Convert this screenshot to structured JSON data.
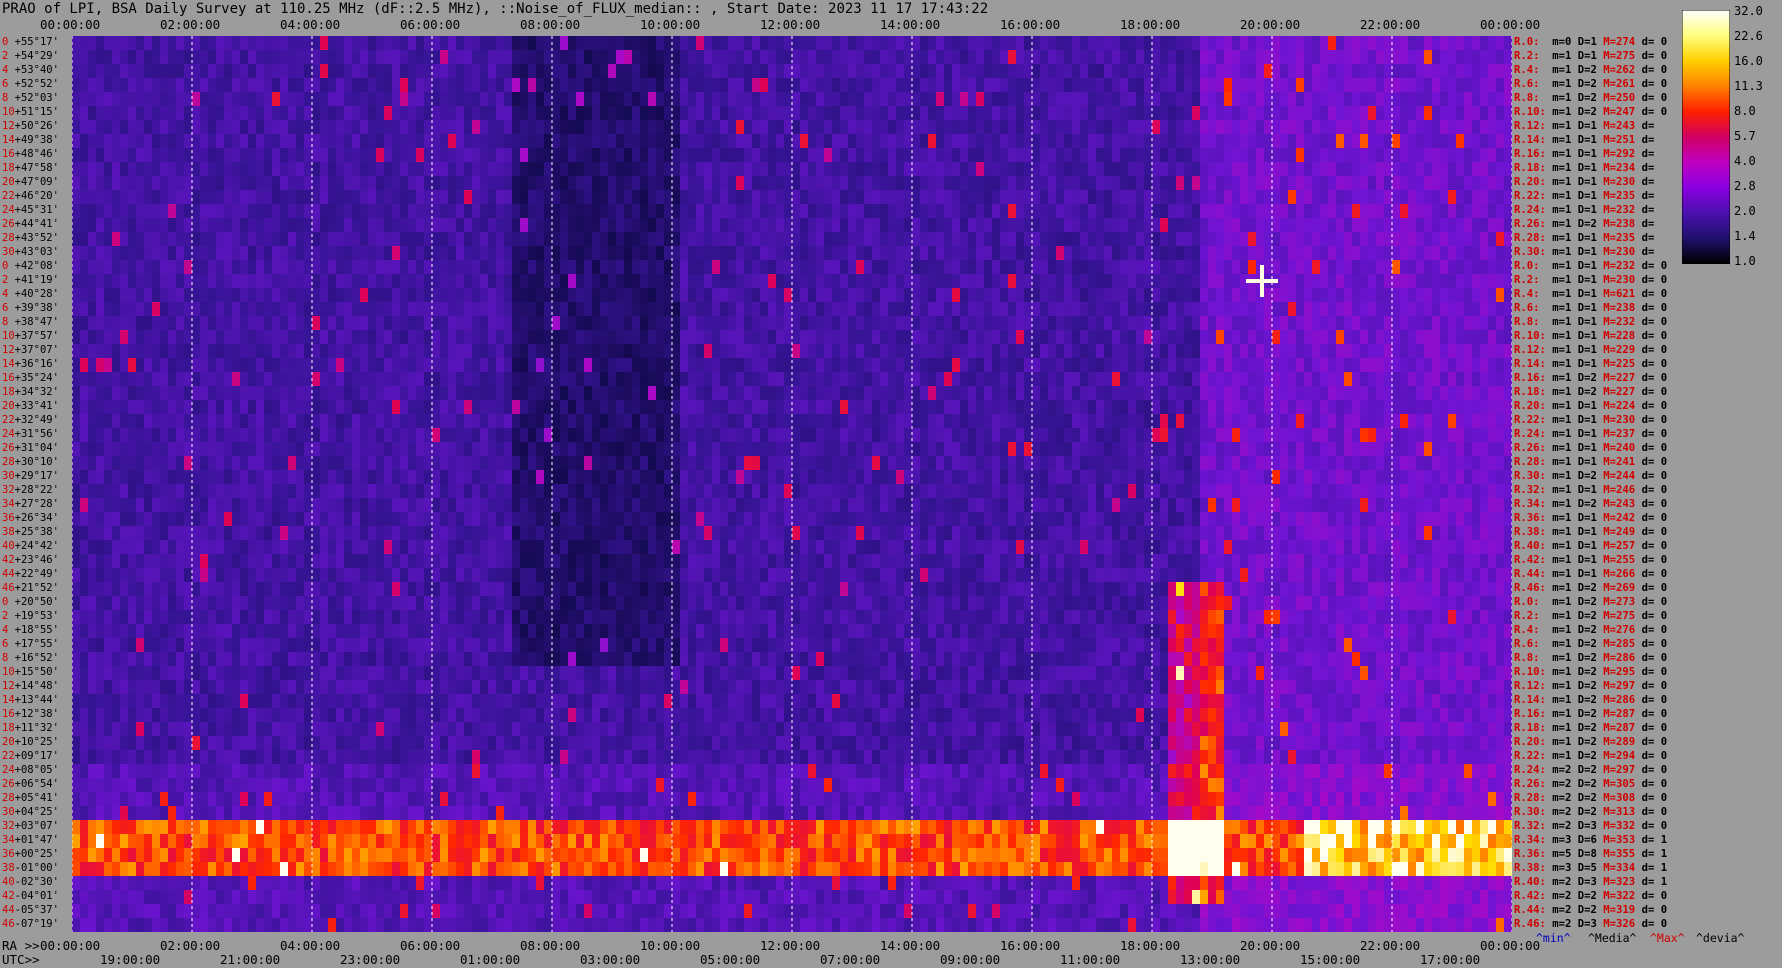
{
  "title": "PRAO of LPI, BSA Daily Survey at 110.25 MHz (dF::2.5 MHz), ::Noise_of_FLUX_median:: , Start Date: 2023 11 17 17:43:22",
  "top_ticks": [
    "00:00:00",
    "02:00:00",
    "04:00:00",
    "06:00:00",
    "08:00:00",
    "10:00:00",
    "12:00:00",
    "14:00:00",
    "16:00:00",
    "18:00:00",
    "20:00:00",
    "22:00:00",
    "00:00:00"
  ],
  "ra_label": "RA >>",
  "ra_ticks": [
    "00:00:00",
    "02:00:00",
    "04:00:00",
    "06:00:00",
    "08:00:00",
    "10:00:00",
    "12:00:00",
    "14:00:00",
    "16:00:00",
    "18:00:00",
    "20:00:00",
    "22:00:00",
    "00:00:00"
  ],
  "utc_label": "UTC>>",
  "utc_ticks": [
    "19:00:00",
    "21:00:00",
    "23:00:00",
    "01:00:00",
    "03:00:00",
    "05:00:00",
    "07:00:00",
    "09:00:00",
    "11:00:00",
    "13:00:00",
    "15:00:00",
    "17:00:00"
  ],
  "colorbar": {
    "ticks": [
      "32.0",
      "22.6",
      "16.0",
      "11.3",
      "8.0",
      "5.7",
      "4.0",
      "2.8",
      "2.0",
      "1.4",
      "1.0"
    ],
    "stops": [
      "#ffffff",
      "#ffff80",
      "#ffd000",
      "#ff8000",
      "#ff2000",
      "#d00060",
      "#c000c0",
      "#8a00e0",
      "#4a10b0",
      "#20106a",
      "#000000"
    ]
  },
  "dec_labels": [
    "+55°17'",
    "+54°29'",
    "+53°40'",
    "+52°52'",
    "+52°03'",
    "+51°15'",
    "+50°26'",
    "+49°38'",
    "+48°46'",
    "+47°58'",
    "+47°09'",
    "+46°20'",
    "+45°31'",
    "+44°41'",
    "+43°52'",
    "+43°03'",
    "+42°08'",
    "+41°19'",
    "+40°28'",
    "+39°38'",
    "+38°47'",
    "+37°57'",
    "+37°07'",
    "+36°16'",
    "+35°24'",
    "+34°32'",
    "+33°41'",
    "+32°49'",
    "+31°56'",
    "+31°04'",
    "+30°10'",
    "+29°17'",
    "+28°22'",
    "+27°28'",
    "+26°34'",
    "+25°38'",
    "+24°42'",
    "+23°46'",
    "+22°49'",
    "+21°52'",
    "+20°50'",
    "+19°53'",
    "+18°55'",
    "+17°55'",
    "+16°52'",
    "+15°50'",
    "+14°48'",
    "+13°44'",
    "+12°38'",
    "+11°32'",
    "+10°25'",
    "+09°17'",
    "+08°05'",
    "+06°54'",
    "+05°41'",
    "+04°25'",
    "+03°07'",
    "+01°47'",
    "+00°25'",
    "-01°00'",
    "-02°30'",
    "-04°01'",
    "-05°37'",
    "-07°19'"
  ],
  "dec_indices": [
    "0",
    "2",
    "4",
    "6",
    "8",
    "10",
    "12",
    "14",
    "16",
    "18",
    "20",
    "22",
    "24",
    "26",
    "28",
    "30",
    "0",
    "2",
    "4",
    "6",
    "8",
    "10",
    "12",
    "14",
    "16",
    "18",
    "20",
    "22",
    "24",
    "26",
    "28",
    "30",
    "32",
    "34",
    "36",
    "38",
    "40",
    "42",
    "44",
    "46",
    "0",
    "2",
    "4",
    "6",
    "8",
    "10",
    "12",
    "14",
    "16",
    "18",
    "20",
    "22",
    "24",
    "26",
    "28",
    "30",
    "32",
    "34",
    "36",
    "38",
    "40",
    "42",
    "44",
    "46"
  ],
  "beams": [
    {
      "r": "R.0:",
      "m": "m=0",
      "d": "D=1",
      "mx": "M=274",
      "dv": "d= 0"
    },
    {
      "r": "R.2:",
      "m": "m=1",
      "d": "D=1",
      "mx": "M=275",
      "dv": "d= 0"
    },
    {
      "r": "R.4:",
      "m": "m=1",
      "d": "D=2",
      "mx": "M=262",
      "dv": "d= 0"
    },
    {
      "r": "R.6:",
      "m": "m=1",
      "d": "D=2",
      "mx": "M=261",
      "dv": "d= 0"
    },
    {
      "r": "R.8:",
      "m": "m=1",
      "d": "D=2",
      "mx": "M=250",
      "dv": "d= 0"
    },
    {
      "r": "R.10:",
      "m": "m=1",
      "d": "D=2",
      "mx": "M=247",
      "dv": "d= 0"
    },
    {
      "r": "R.12:",
      "m": "m=1",
      "d": "D=1",
      "mx": "M=243",
      "dv": "d="
    },
    {
      "r": "R.14:",
      "m": "m=1",
      "d": "D=1",
      "mx": "M=251",
      "dv": "d="
    },
    {
      "r": "R.16:",
      "m": "m=1",
      "d": "D=1",
      "mx": "M=292",
      "dv": "d="
    },
    {
      "r": "R.18:",
      "m": "m=1",
      "d": "D=1",
      "mx": "M=234",
      "dv": "d="
    },
    {
      "r": "R.20:",
      "m": "m=1",
      "d": "D=1",
      "mx": "M=230",
      "dv": "d="
    },
    {
      "r": "R.22:",
      "m": "m=1",
      "d": "D=1",
      "mx": "M=235",
      "dv": "d="
    },
    {
      "r": "R.24:",
      "m": "m=1",
      "d": "D=1",
      "mx": "M=232",
      "dv": "d="
    },
    {
      "r": "R.26:",
      "m": "m=1",
      "d": "D=2",
      "mx": "M=238",
      "dv": "d="
    },
    {
      "r": "R.28:",
      "m": "m=1",
      "d": "D=1",
      "mx": "M=235",
      "dv": "d="
    },
    {
      "r": "R.30:",
      "m": "m=1",
      "d": "D=1",
      "mx": "M=230",
      "dv": "d="
    },
    {
      "r": "R.0:",
      "m": "m=1",
      "d": "D=1",
      "mx": "M=232",
      "dv": "d= 0"
    },
    {
      "r": "R.2:",
      "m": "m=1",
      "d": "D=1",
      "mx": "M=230",
      "dv": "d= 0"
    },
    {
      "r": "R.4:",
      "m": "m=1",
      "d": "D=1",
      "mx": "M=621",
      "dv": "d= 0"
    },
    {
      "r": "R.6:",
      "m": "m=1",
      "d": "D=1",
      "mx": "M=238",
      "dv": "d= 0"
    },
    {
      "r": "R.8:",
      "m": "m=1",
      "d": "D=1",
      "mx": "M=232",
      "dv": "d= 0"
    },
    {
      "r": "R.10:",
      "m": "m=1",
      "d": "D=1",
      "mx": "M=228",
      "dv": "d= 0"
    },
    {
      "r": "R.12:",
      "m": "m=1",
      "d": "D=1",
      "mx": "M=229",
      "dv": "d= 0"
    },
    {
      "r": "R.14:",
      "m": "m=1",
      "d": "D=1",
      "mx": "M=225",
      "dv": "d= 0"
    },
    {
      "r": "R.16:",
      "m": "m=1",
      "d": "D=2",
      "mx": "M=227",
      "dv": "d= 0"
    },
    {
      "r": "R.18:",
      "m": "m=1",
      "d": "D=2",
      "mx": "M=227",
      "dv": "d= 0"
    },
    {
      "r": "R.20:",
      "m": "m=1",
      "d": "D=1",
      "mx": "M=224",
      "dv": "d= 0"
    },
    {
      "r": "R.22:",
      "m": "m=1",
      "d": "D=1",
      "mx": "M=230",
      "dv": "d= 0"
    },
    {
      "r": "R.24:",
      "m": "m=1",
      "d": "D=1",
      "mx": "M=237",
      "dv": "d= 0"
    },
    {
      "r": "R.26:",
      "m": "m=1",
      "d": "D=1",
      "mx": "M=240",
      "dv": "d= 0"
    },
    {
      "r": "R.28:",
      "m": "m=1",
      "d": "D=1",
      "mx": "M=241",
      "dv": "d= 0"
    },
    {
      "r": "R.30:",
      "m": "m=1",
      "d": "D=2",
      "mx": "M=244",
      "dv": "d= 0"
    },
    {
      "r": "R.32:",
      "m": "m=1",
      "d": "D=1",
      "mx": "M=246",
      "dv": "d= 0"
    },
    {
      "r": "R.34:",
      "m": "m=1",
      "d": "D=2",
      "mx": "M=243",
      "dv": "d= 0"
    },
    {
      "r": "R.36:",
      "m": "m=1",
      "d": "D=1",
      "mx": "M=242",
      "dv": "d= 0"
    },
    {
      "r": "R.38:",
      "m": "m=1",
      "d": "D=1",
      "mx": "M=249",
      "dv": "d= 0"
    },
    {
      "r": "R.40:",
      "m": "m=1",
      "d": "D=1",
      "mx": "M=257",
      "dv": "d= 0"
    },
    {
      "r": "R.42:",
      "m": "m=1",
      "d": "D=1",
      "mx": "M=255",
      "dv": "d= 0"
    },
    {
      "r": "R.44:",
      "m": "m=1",
      "d": "D=1",
      "mx": "M=266",
      "dv": "d= 0"
    },
    {
      "r": "R.46:",
      "m": "m=1",
      "d": "D=2",
      "mx": "M=269",
      "dv": "d= 0"
    },
    {
      "r": "R.0:",
      "m": "m=1",
      "d": "D=2",
      "mx": "M=273",
      "dv": "d= 0"
    },
    {
      "r": "R.2:",
      "m": "m=1",
      "d": "D=2",
      "mx": "M=275",
      "dv": "d= 0"
    },
    {
      "r": "R.4:",
      "m": "m=1",
      "d": "D=2",
      "mx": "M=276",
      "dv": "d= 0"
    },
    {
      "r": "R.6:",
      "m": "m=1",
      "d": "D=2",
      "mx": "M=285",
      "dv": "d= 0"
    },
    {
      "r": "R.8:",
      "m": "m=1",
      "d": "D=2",
      "mx": "M=286",
      "dv": "d= 0"
    },
    {
      "r": "R.10:",
      "m": "m=1",
      "d": "D=2",
      "mx": "M=295",
      "dv": "d= 0"
    },
    {
      "r": "R.12:",
      "m": "m=1",
      "d": "D=2",
      "mx": "M=297",
      "dv": "d= 0"
    },
    {
      "r": "R.14:",
      "m": "m=1",
      "d": "D=2",
      "mx": "M=286",
      "dv": "d= 0"
    },
    {
      "r": "R.16:",
      "m": "m=1",
      "d": "D=2",
      "mx": "M=287",
      "dv": "d= 0"
    },
    {
      "r": "R.18:",
      "m": "m=1",
      "d": "D=2",
      "mx": "M=287",
      "dv": "d= 0"
    },
    {
      "r": "R.20:",
      "m": "m=1",
      "d": "D=2",
      "mx": "M=289",
      "dv": "d= 0"
    },
    {
      "r": "R.22:",
      "m": "m=1",
      "d": "D=2",
      "mx": "M=294",
      "dv": "d= 0"
    },
    {
      "r": "R.24:",
      "m": "m=2",
      "d": "D=2",
      "mx": "M=297",
      "dv": "d= 0"
    },
    {
      "r": "R.26:",
      "m": "m=2",
      "d": "D=2",
      "mx": "M=305",
      "dv": "d= 0"
    },
    {
      "r": "R.28:",
      "m": "m=2",
      "d": "D=2",
      "mx": "M=308",
      "dv": "d= 0"
    },
    {
      "r": "R.30:",
      "m": "m=2",
      "d": "D=2",
      "mx": "M=313",
      "dv": "d= 0"
    },
    {
      "r": "R.32:",
      "m": "m=2",
      "d": "D=3",
      "mx": "M=332",
      "dv": "d= 0"
    },
    {
      "r": "R.34:",
      "m": "m=3",
      "d": "D=6",
      "mx": "M=353",
      "dv": "d= 1"
    },
    {
      "r": "R.36:",
      "m": "m=5",
      "d": "D=8",
      "mx": "M=355",
      "dv": "d= 1"
    },
    {
      "r": "R.38:",
      "m": "m=3",
      "d": "D=5",
      "mx": "M=334",
      "dv": "d= 1"
    },
    {
      "r": "R.40:",
      "m": "m=2",
      "d": "D=3",
      "mx": "M=323",
      "dv": "d= 1"
    },
    {
      "r": "R.42:",
      "m": "m=2",
      "d": "D=2",
      "mx": "M=322",
      "dv": "d= 0"
    },
    {
      "r": "R.44:",
      "m": "m=2",
      "d": "D=2",
      "mx": "M=319",
      "dv": "d= 0"
    },
    {
      "r": "R.46:",
      "m": "m=2",
      "d": "D=3",
      "mx": "M=326",
      "dv": "d= 0"
    }
  ],
  "footer": {
    "min": "^min^",
    "median": "^Media^",
    "max": "^Max^",
    "devia": "^devia^"
  },
  "chart_data": {
    "type": "heatmap",
    "title": "PRAO of LPI, BSA Daily Survey at 110.25 MHz (dF::2.5 MHz), ::Noise_of_FLUX_median:: , Start Date: 2023 11 17 17:43:22",
    "x_axis": "RA 00:00:00 to 00:00:00 (24 h); UTC 19:00:00 to 17:00:00",
    "y_axis": "Declination +55°17' to -07°19' (64 beams)",
    "color_scale": "log, 1.0 to 32.0",
    "features": [
      {
        "name": "bright band",
        "dec_range": [
          "+01°47'",
          "-01°00'"
        ],
        "ra_range": [
          "00:00:00",
          "24:00:00"
        ],
        "level": "8.0-32.0"
      },
      {
        "name": "bright source",
        "ra": "20:00:00",
        "dec": "+41°19'",
        "level": "32.0"
      },
      {
        "name": "bright emission column",
        "ra_range": [
          "18:30:00",
          "20:00:00"
        ],
        "dec_range": [
          "+22°49'",
          "-07°19'"
        ],
        "level": "4.0-11.3"
      },
      {
        "name": "background",
        "level": "1.0-2.8"
      }
    ]
  }
}
